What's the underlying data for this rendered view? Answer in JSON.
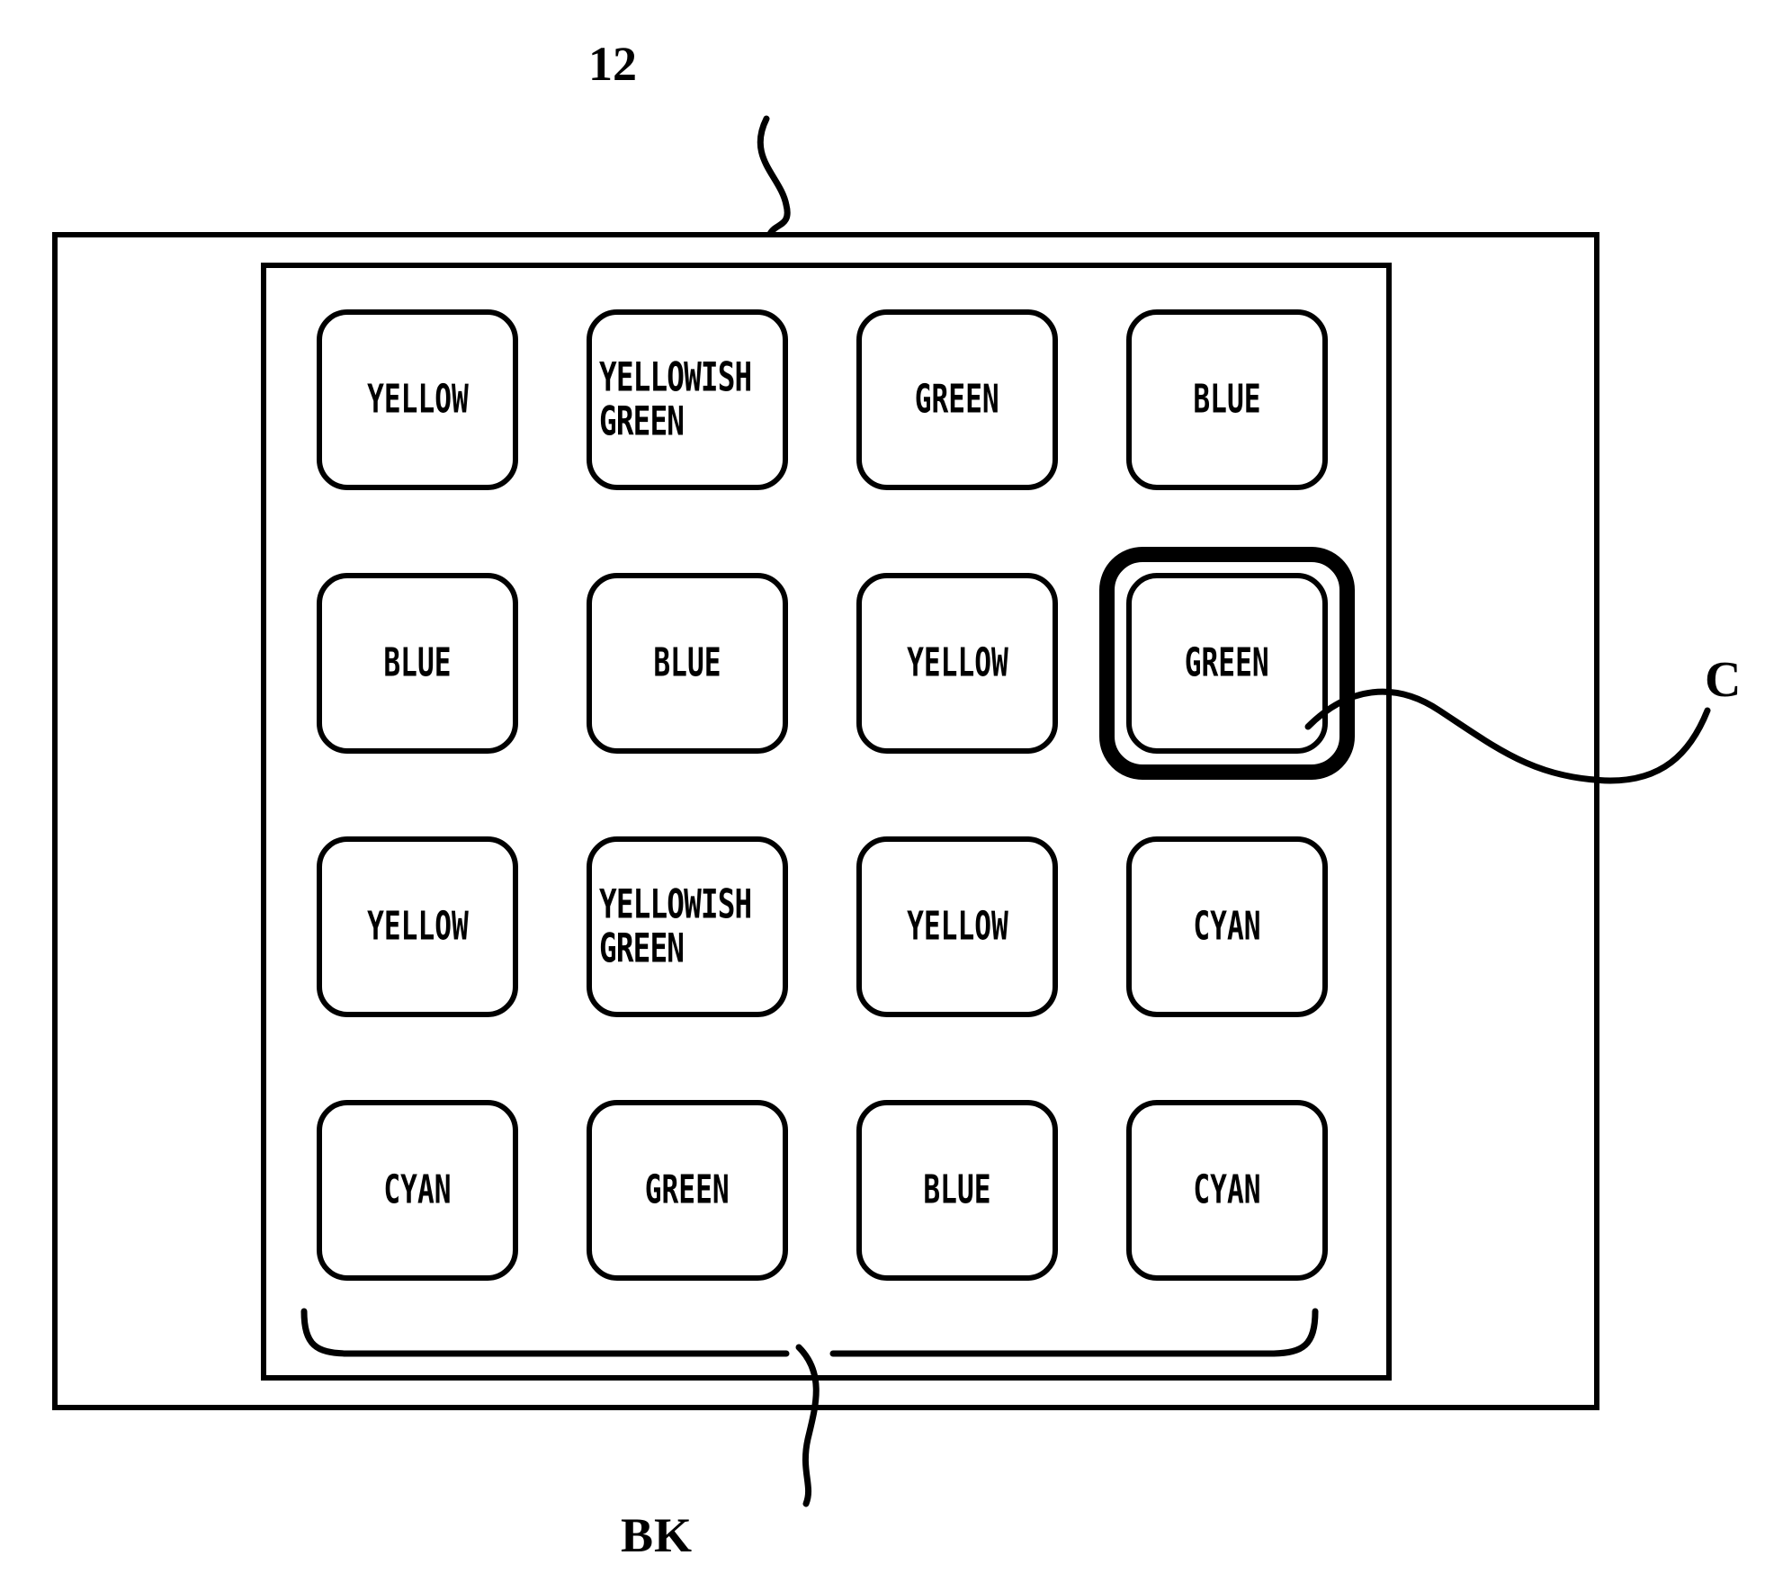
{
  "figure": {
    "device_ref": "12",
    "selection_ref": "C",
    "block_group_ref": "BK"
  },
  "grid": {
    "rows": 4,
    "columns": 4,
    "selected_index": 7,
    "blocks": [
      {
        "label": "YELLOW",
        "lines": [
          "YELLOW"
        ],
        "two_line": false,
        "selected": false
      },
      {
        "label": "YELLOWISH GREEN",
        "lines": [
          "YELLOWISH",
          "GREEN"
        ],
        "two_line": true,
        "selected": false
      },
      {
        "label": "GREEN",
        "lines": [
          "GREEN"
        ],
        "two_line": false,
        "selected": false
      },
      {
        "label": "BLUE",
        "lines": [
          "BLUE"
        ],
        "two_line": false,
        "selected": false
      },
      {
        "label": "BLUE",
        "lines": [
          "BLUE"
        ],
        "two_line": false,
        "selected": false
      },
      {
        "label": "BLUE",
        "lines": [
          "BLUE"
        ],
        "two_line": false,
        "selected": false
      },
      {
        "label": "YELLOW",
        "lines": [
          "YELLOW"
        ],
        "two_line": false,
        "selected": false
      },
      {
        "label": "GREEN",
        "lines": [
          "GREEN"
        ],
        "two_line": false,
        "selected": true
      },
      {
        "label": "YELLOW",
        "lines": [
          "YELLOW"
        ],
        "two_line": false,
        "selected": false
      },
      {
        "label": "YELLOWISH GREEN",
        "lines": [
          "YELLOWISH",
          "GREEN"
        ],
        "two_line": true,
        "selected": false
      },
      {
        "label": "YELLOW",
        "lines": [
          "YELLOW"
        ],
        "two_line": false,
        "selected": false
      },
      {
        "label": "CYAN",
        "lines": [
          "CYAN"
        ],
        "two_line": false,
        "selected": false
      },
      {
        "label": "CYAN",
        "lines": [
          "CYAN"
        ],
        "two_line": false,
        "selected": false
      },
      {
        "label": "GREEN",
        "lines": [
          "GREEN"
        ],
        "two_line": false,
        "selected": false
      },
      {
        "label": "BLUE",
        "lines": [
          "BLUE"
        ],
        "two_line": false,
        "selected": false
      },
      {
        "label": "CYAN",
        "lines": [
          "CYAN"
        ],
        "two_line": false,
        "selected": false
      }
    ]
  },
  "colors": {
    "line": "#000000",
    "background": "#ffffff"
  }
}
